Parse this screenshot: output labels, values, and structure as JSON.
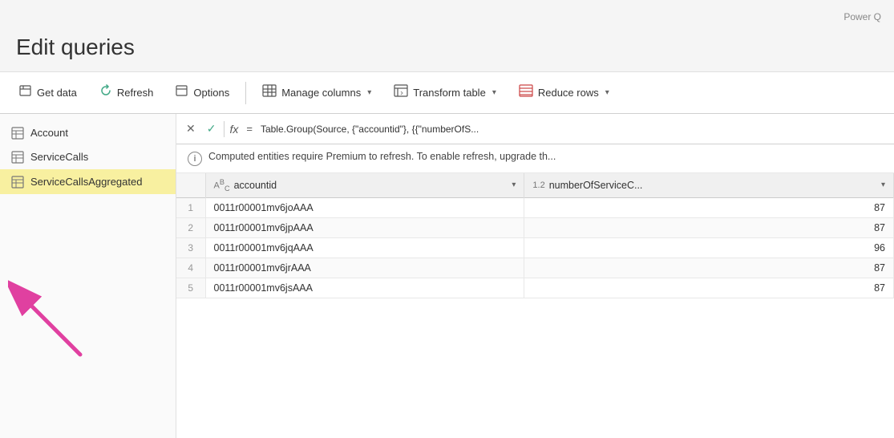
{
  "app": {
    "power_label": "Power Q",
    "title": "Edit queries"
  },
  "toolbar": {
    "get_data_label": "Get data",
    "refresh_label": "Refresh",
    "options_label": "Options",
    "manage_columns_label": "Manage columns",
    "transform_table_label": "Transform table",
    "reduce_rows_label": "Reduce rows"
  },
  "sidebar": {
    "items": [
      {
        "label": "Account",
        "active": false
      },
      {
        "label": "ServiceCalls",
        "active": false
      },
      {
        "label": "ServiceCallsAggregated",
        "active": true
      }
    ]
  },
  "formula_bar": {
    "cancel_label": "✕",
    "accept_label": "✓",
    "fx_label": "fx",
    "equals": "=",
    "formula": "Table.Group(Source, {\"accountid\"}, {{\"numberOfS..."
  },
  "info_bar": {
    "message": "Computed entities require Premium to refresh. To enable refresh, upgrade th..."
  },
  "table": {
    "columns": [
      {
        "type": "ABC",
        "label": "accountid"
      },
      {
        "type": "1.2",
        "label": "numberOfServiceC..."
      }
    ],
    "rows": [
      {
        "num": 1,
        "accountid": "0011r00001mv6joAAA",
        "value": 87
      },
      {
        "num": 2,
        "accountid": "0011r00001mv6jpAAA",
        "value": 87
      },
      {
        "num": 3,
        "accountid": "0011r00001mv6jqAAA",
        "value": 96
      },
      {
        "num": 4,
        "accountid": "0011r00001mv6jrAAA",
        "value": 87
      },
      {
        "num": 5,
        "accountid": "0011r00001mv6jsAAA",
        "value": 87
      }
    ]
  }
}
